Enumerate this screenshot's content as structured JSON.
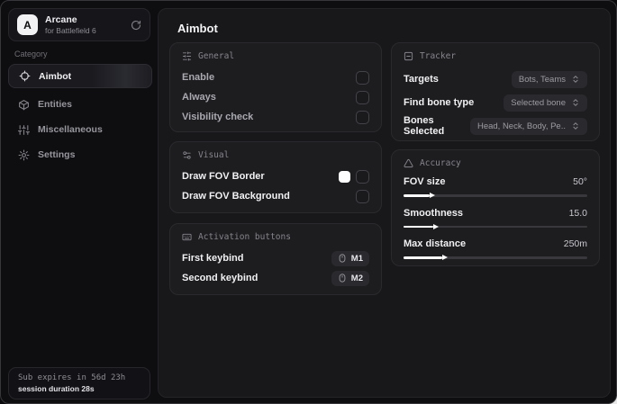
{
  "colors": {
    "window_bg": "#0e0e10",
    "panel_bg": "#18181a",
    "card_bg": "#1d1d20",
    "fov_border_swatch": "#ffffff"
  },
  "sidebar": {
    "brand": {
      "name": "Arcane",
      "subtitle": "for Battlefield 6",
      "logo_letter": "A"
    },
    "category_label": "Category",
    "items": [
      {
        "label": "Aimbot",
        "selected": true
      },
      {
        "label": "Entities",
        "selected": false
      },
      {
        "label": "Miscellaneous",
        "selected": false
      },
      {
        "label": "Settings",
        "selected": false
      }
    ],
    "footer": {
      "line1": "Sub expires in 56d 23h",
      "line2": "session duration 28s"
    }
  },
  "main": {
    "title": "Aimbot",
    "cards": {
      "general": {
        "title": "General",
        "rows": [
          {
            "label": "Enable",
            "checked": false
          },
          {
            "label": "Always",
            "checked": false
          },
          {
            "label": "Visibility check",
            "checked": false
          }
        ]
      },
      "visual": {
        "title": "Visual",
        "rows": [
          {
            "label": "Draw FOV Border",
            "swatch": "#ffffff",
            "checked": false
          },
          {
            "label": "Draw FOV Background",
            "checked": false
          }
        ]
      },
      "activation": {
        "title": "Activation buttons",
        "rows": [
          {
            "label": "First keybind",
            "key": "M1"
          },
          {
            "label": "Second keybind",
            "key": "M2"
          }
        ]
      },
      "tracker": {
        "title": "Tracker",
        "rows": [
          {
            "label": "Targets",
            "value": "Bots, Teams"
          },
          {
            "label": "Find bone type",
            "value": "Selected bone"
          },
          {
            "label": "Bones Selected",
            "value": "Head, Neck, Body, Pe.."
          }
        ]
      },
      "accuracy": {
        "title": "Accuracy",
        "sliders": [
          {
            "label": "FOV size",
            "value": "50°",
            "percent": 14
          },
          {
            "label": "Smoothness",
            "value": "15.0",
            "percent": 16
          },
          {
            "label": "Max distance",
            "value": "250m",
            "percent": 21
          }
        ]
      }
    }
  }
}
